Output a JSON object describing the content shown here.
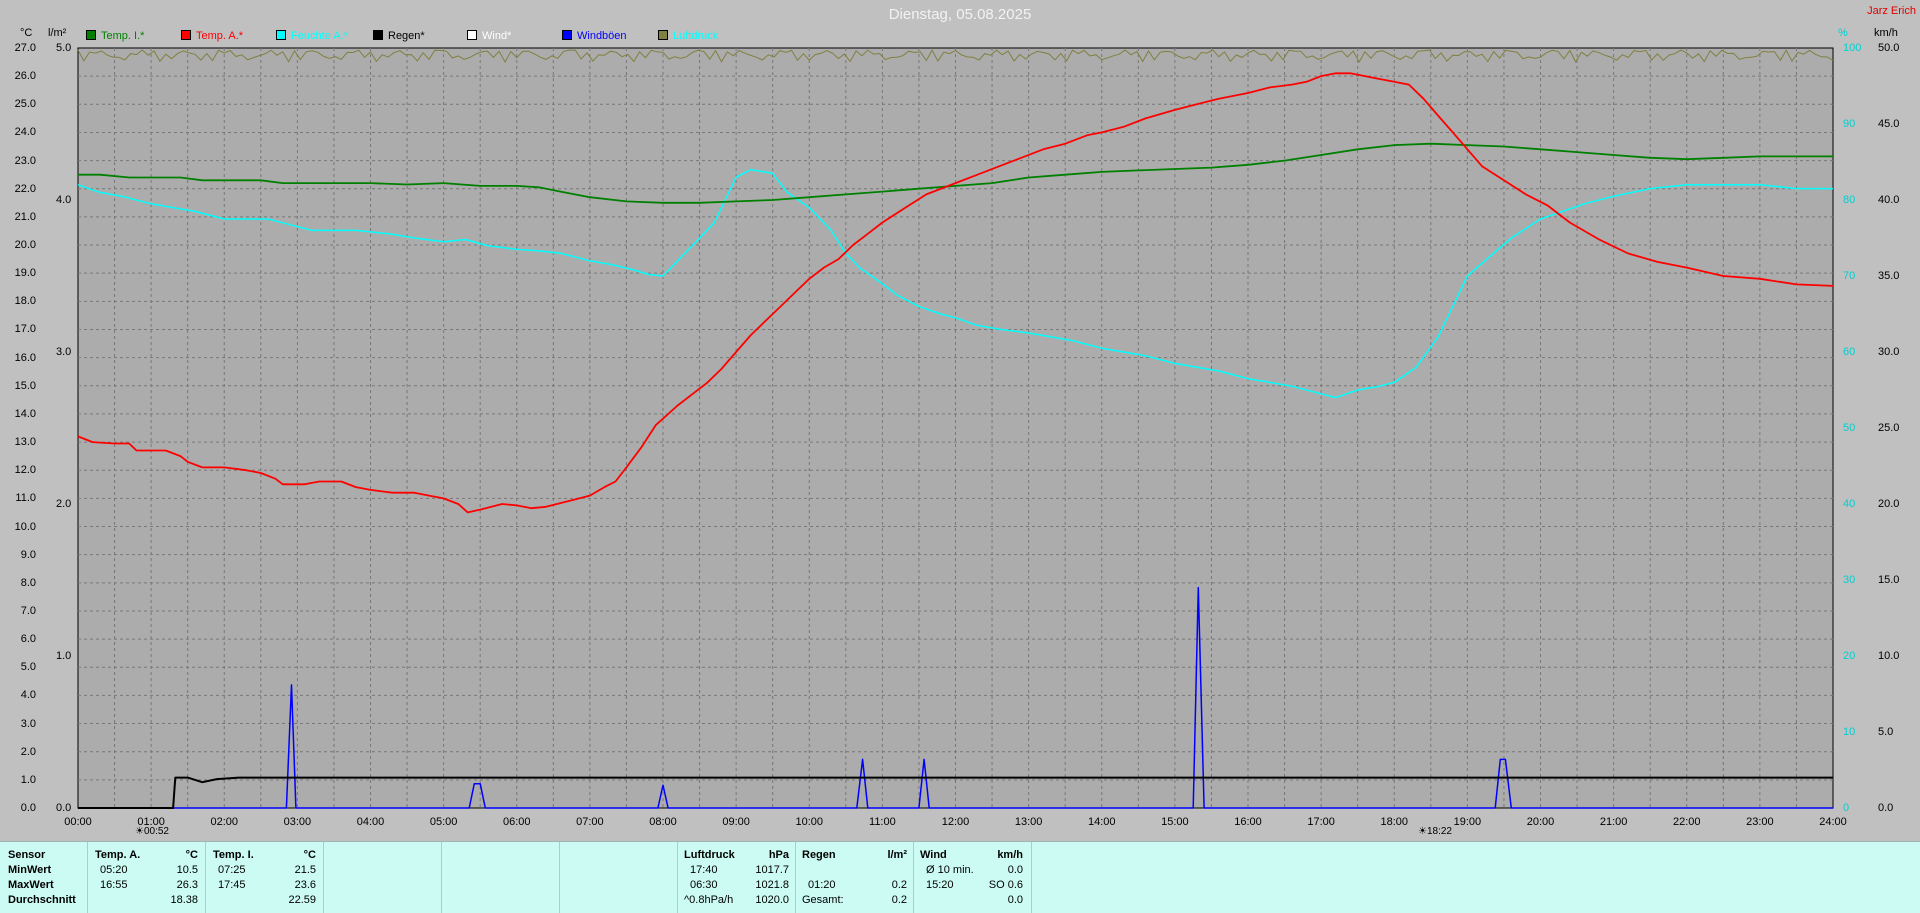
{
  "header": {
    "title": "Dienstag, 05.08.2025",
    "author": "Jarz Erich"
  },
  "units": {
    "temp": "°C",
    "rain": "l/m²",
    "pct": "%",
    "wind": "km/h"
  },
  "legend": [
    {
      "label": "Temp. I.*",
      "color": "#008000"
    },
    {
      "label": "Temp. A.*",
      "color": "#ff0000"
    },
    {
      "label": "Feuchte A.*",
      "color": "#00ffff"
    },
    {
      "label": "Regen*",
      "color": "#000000"
    },
    {
      "label": "Wind*",
      "color": "#ffffff"
    },
    {
      "label": "Windböen",
      "color": "#0000ff"
    },
    {
      "label": "Luftdruck",
      "color": "#808040"
    }
  ],
  "sun": {
    "sunrise": "00:52",
    "sunset": "18:22"
  },
  "chart_data": {
    "type": "line",
    "title": "Dienstag, 05.08.2025",
    "x_ticks": [
      "00:00",
      "01:00",
      "02:00",
      "03:00",
      "04:00",
      "05:00",
      "06:00",
      "07:00",
      "08:00",
      "09:00",
      "10:00",
      "11:00",
      "12:00",
      "13:00",
      "14:00",
      "15:00",
      "16:00",
      "17:00",
      "18:00",
      "19:00",
      "20:00",
      "21:00",
      "22:00",
      "23:00",
      "24:00"
    ],
    "temp_ticks": [
      "27.0",
      "26.0",
      "25.0",
      "24.0",
      "23.0",
      "22.0",
      "21.0",
      "20.0",
      "19.0",
      "18.0",
      "17.0",
      "16.0",
      "15.0",
      "14.0",
      "13.0",
      "12.0",
      "11.0",
      "10.0",
      "9.0",
      "8.0",
      "7.0",
      "6.0",
      "5.0",
      "4.0",
      "3.0",
      "2.0",
      "1.0",
      "0.0"
    ],
    "rain_ticks": [
      "5.0",
      "4.0",
      "3.0",
      "2.0",
      "1.0",
      "0.0"
    ],
    "humidity_ticks": [
      "100",
      "90",
      "80",
      "70",
      "60",
      "50",
      "40",
      "30",
      "20",
      "10",
      "0"
    ],
    "wind_ticks": [
      "50.0",
      "45.0",
      "40.0",
      "35.0",
      "30.0",
      "25.0",
      "20.0",
      "15.0",
      "10.0",
      "5.0",
      "0.0"
    ],
    "ylim_temp": [
      0,
      27
    ],
    "ylim_rain": [
      0,
      5
    ],
    "ylim_humidity": [
      0,
      100
    ],
    "ylim_wind": [
      0,
      50
    ],
    "grid": true,
    "series": [
      {
        "name": "Temp. A.*",
        "color": "#ff0000",
        "axis": "temp",
        "points": [
          [
            0,
            13.2
          ],
          [
            0.2,
            13
          ],
          [
            0.5,
            12.95
          ],
          [
            0.7,
            12.95
          ],
          [
            0.8,
            12.7
          ],
          [
            1.2,
            12.7
          ],
          [
            1.4,
            12.5
          ],
          [
            1.5,
            12.3
          ],
          [
            1.7,
            12.1
          ],
          [
            2,
            12.1
          ],
          [
            2.3,
            12
          ],
          [
            2.5,
            11.9
          ],
          [
            2.7,
            11.7
          ],
          [
            2.8,
            11.5
          ],
          [
            3.1,
            11.5
          ],
          [
            3.3,
            11.6
          ],
          [
            3.6,
            11.6
          ],
          [
            3.8,
            11.4
          ],
          [
            4,
            11.3
          ],
          [
            4.3,
            11.2
          ],
          [
            4.6,
            11.2
          ],
          [
            4.8,
            11.1
          ],
          [
            5,
            11
          ],
          [
            5.2,
            10.8
          ],
          [
            5.33,
            10.5
          ],
          [
            5.5,
            10.6
          ],
          [
            5.8,
            10.8
          ],
          [
            6,
            10.75
          ],
          [
            6.2,
            10.65
          ],
          [
            6.4,
            10.7
          ],
          [
            6.7,
            10.9
          ],
          [
            7,
            11.1
          ],
          [
            7.2,
            11.4
          ],
          [
            7.35,
            11.6
          ],
          [
            7.5,
            12.1
          ],
          [
            7.7,
            12.8
          ],
          [
            7.9,
            13.6
          ],
          [
            8.2,
            14.3
          ],
          [
            8.4,
            14.7
          ],
          [
            8.6,
            15.1
          ],
          [
            8.8,
            15.6
          ],
          [
            9,
            16.2
          ],
          [
            9.2,
            16.8
          ],
          [
            9.4,
            17.3
          ],
          [
            9.6,
            17.8
          ],
          [
            9.8,
            18.3
          ],
          [
            10,
            18.8
          ],
          [
            10.2,
            19.2
          ],
          [
            10.4,
            19.5
          ],
          [
            10.6,
            20
          ],
          [
            10.8,
            20.4
          ],
          [
            11,
            20.8
          ],
          [
            11.3,
            21.3
          ],
          [
            11.6,
            21.8
          ],
          [
            12,
            22.2
          ],
          [
            12.3,
            22.5
          ],
          [
            12.6,
            22.8
          ],
          [
            12.9,
            23.1
          ],
          [
            13.2,
            23.4
          ],
          [
            13.5,
            23.6
          ],
          [
            13.8,
            23.9
          ],
          [
            14,
            24
          ],
          [
            14.3,
            24.2
          ],
          [
            14.6,
            24.5
          ],
          [
            15,
            24.8
          ],
          [
            15.3,
            25
          ],
          [
            15.6,
            25.2
          ],
          [
            16,
            25.4
          ],
          [
            16.3,
            25.6
          ],
          [
            16.6,
            25.7
          ],
          [
            16.8,
            25.8
          ],
          [
            17,
            26
          ],
          [
            17.2,
            26.1
          ],
          [
            17.4,
            26.1
          ],
          [
            17.6,
            26
          ],
          [
            17.8,
            25.9
          ],
          [
            18,
            25.8
          ],
          [
            18.2,
            25.7
          ],
          [
            18.4,
            25.2
          ],
          [
            18.6,
            24.6
          ],
          [
            18.8,
            24
          ],
          [
            19,
            23.4
          ],
          [
            19.2,
            22.8
          ],
          [
            19.5,
            22.3
          ],
          [
            19.8,
            21.8
          ],
          [
            20.1,
            21.4
          ],
          [
            20.4,
            20.8
          ],
          [
            20.8,
            20.2
          ],
          [
            21.2,
            19.7
          ],
          [
            21.6,
            19.4
          ],
          [
            22,
            19.2
          ],
          [
            22.5,
            18.9
          ],
          [
            23,
            18.8
          ],
          [
            23.5,
            18.6
          ],
          [
            24,
            18.55
          ]
        ]
      },
      {
        "name": "Temp. I.*",
        "color": "#008000",
        "axis": "temp",
        "points": [
          [
            0,
            22.5
          ],
          [
            0.3,
            22.5
          ],
          [
            0.7,
            22.4
          ],
          [
            1,
            22.4
          ],
          [
            1.4,
            22.4
          ],
          [
            1.7,
            22.3
          ],
          [
            2,
            22.3
          ],
          [
            2.5,
            22.3
          ],
          [
            2.8,
            22.2
          ],
          [
            3,
            22.2
          ],
          [
            3.5,
            22.2
          ],
          [
            4,
            22.2
          ],
          [
            4.5,
            22.15
          ],
          [
            5,
            22.2
          ],
          [
            5.5,
            22.1
          ],
          [
            6,
            22.1
          ],
          [
            6.3,
            22.05
          ],
          [
            6.6,
            21.9
          ],
          [
            7,
            21.7
          ],
          [
            7.5,
            21.55
          ],
          [
            8,
            21.5
          ],
          [
            8.5,
            21.5
          ],
          [
            9,
            21.55
          ],
          [
            9.5,
            21.6
          ],
          [
            10,
            21.7
          ],
          [
            10.5,
            21.8
          ],
          [
            11,
            21.9
          ],
          [
            11.5,
            22
          ],
          [
            12,
            22.1
          ],
          [
            12.5,
            22.2
          ],
          [
            13,
            22.4
          ],
          [
            13.5,
            22.5
          ],
          [
            14,
            22.6
          ],
          [
            14.5,
            22.65
          ],
          [
            15,
            22.7
          ],
          [
            15.5,
            22.75
          ],
          [
            16,
            22.85
          ],
          [
            16.5,
            23
          ],
          [
            17,
            23.2
          ],
          [
            17.5,
            23.4
          ],
          [
            18,
            23.55
          ],
          [
            18.5,
            23.6
          ],
          [
            19,
            23.55
          ],
          [
            19.5,
            23.5
          ],
          [
            20,
            23.4
          ],
          [
            20.5,
            23.3
          ],
          [
            21,
            23.2
          ],
          [
            21.5,
            23.1
          ],
          [
            22,
            23.05
          ],
          [
            22.5,
            23.1
          ],
          [
            23,
            23.15
          ],
          [
            23.5,
            23.15
          ],
          [
            24,
            23.15
          ]
        ]
      },
      {
        "name": "Feuchte A.*",
        "color": "#00ffff",
        "axis": "humidity",
        "points": [
          [
            0,
            82
          ],
          [
            0.3,
            81
          ],
          [
            0.6,
            80.5
          ],
          [
            1,
            79.5
          ],
          [
            1.3,
            79
          ],
          [
            1.6,
            78.5
          ],
          [
            2,
            77.5
          ],
          [
            2.3,
            77.5
          ],
          [
            2.6,
            77.5
          ],
          [
            2.8,
            77
          ],
          [
            3.2,
            76
          ],
          [
            3.5,
            76
          ],
          [
            3.8,
            76
          ],
          [
            4,
            75.8
          ],
          [
            4.3,
            75.5
          ],
          [
            4.6,
            75
          ],
          [
            5,
            74.5
          ],
          [
            5.3,
            74.8
          ],
          [
            5.6,
            74
          ],
          [
            6,
            73.5
          ],
          [
            6.3,
            73.3
          ],
          [
            6.6,
            73
          ],
          [
            7,
            72
          ],
          [
            7.3,
            71.5
          ],
          [
            7.6,
            70.8
          ],
          [
            7.8,
            70.2
          ],
          [
            8,
            70
          ],
          [
            8.2,
            72
          ],
          [
            8.4,
            74
          ],
          [
            8.7,
            77
          ],
          [
            9,
            83
          ],
          [
            9.2,
            84
          ],
          [
            9.5,
            83.5
          ],
          [
            9.7,
            81
          ],
          [
            10,
            79
          ],
          [
            10.3,
            76
          ],
          [
            10.5,
            73
          ],
          [
            10.7,
            71
          ],
          [
            11,
            69
          ],
          [
            11.2,
            67.5
          ],
          [
            11.5,
            66
          ],
          [
            11.8,
            65
          ],
          [
            12,
            64.5
          ],
          [
            12.3,
            63.5
          ],
          [
            12.6,
            63
          ],
          [
            13,
            62.5
          ],
          [
            13.3,
            62
          ],
          [
            13.6,
            61.5
          ],
          [
            14,
            60.5
          ],
          [
            14.3,
            60
          ],
          [
            14.6,
            59.5
          ],
          [
            15,
            58.5
          ],
          [
            15.3,
            58
          ],
          [
            15.6,
            57.5
          ],
          [
            16,
            56.5
          ],
          [
            16.3,
            56
          ],
          [
            16.6,
            55.5
          ],
          [
            17,
            54.5
          ],
          [
            17.2,
            54
          ],
          [
            17.5,
            55
          ],
          [
            17.8,
            55.5
          ],
          [
            18,
            56
          ],
          [
            18.3,
            58
          ],
          [
            18.6,
            62
          ],
          [
            18.8,
            66
          ],
          [
            19,
            70
          ],
          [
            19.3,
            72.5
          ],
          [
            19.6,
            75
          ],
          [
            20,
            77.5
          ],
          [
            20.3,
            78.5
          ],
          [
            20.6,
            79.5
          ],
          [
            21,
            80.5
          ],
          [
            21.5,
            81.5
          ],
          [
            22,
            82
          ],
          [
            22.5,
            82
          ],
          [
            23,
            82
          ],
          [
            23.5,
            81.5
          ],
          [
            24,
            81.5
          ]
        ]
      },
      {
        "name": "Regen*",
        "color": "#000000",
        "axis": "rain",
        "points": [
          [
            0,
            0
          ],
          [
            1.3,
            0
          ],
          [
            1.33,
            0.2
          ],
          [
            1.5,
            0.2
          ],
          [
            1.7,
            0.17
          ],
          [
            1.9,
            0.19
          ],
          [
            2.2,
            0.2
          ],
          [
            3,
            0.2
          ],
          [
            24,
            0.2
          ]
        ]
      },
      {
        "name": "Windböen",
        "color": "#0000ff",
        "axis": "wind",
        "points": [
          [
            0,
            0
          ],
          [
            2.85,
            0
          ],
          [
            2.92,
            8.1
          ],
          [
            2.98,
            0
          ],
          [
            5.35,
            0
          ],
          [
            5.42,
            1.6
          ],
          [
            5.5,
            1.6
          ],
          [
            5.57,
            0
          ],
          [
            7.93,
            0
          ],
          [
            8.0,
            1.5
          ],
          [
            8.07,
            0
          ],
          [
            10.65,
            0
          ],
          [
            10.73,
            3.2
          ],
          [
            10.8,
            0
          ],
          [
            11.5,
            0
          ],
          [
            11.57,
            3.2
          ],
          [
            11.64,
            0
          ],
          [
            15.25,
            0
          ],
          [
            15.32,
            14.5
          ],
          [
            15.4,
            0
          ],
          [
            19.38,
            0
          ],
          [
            19.45,
            3.2
          ],
          [
            19.52,
            3.2
          ],
          [
            19.6,
            0
          ],
          [
            24,
            0
          ]
        ]
      },
      {
        "name": "Luftdruck",
        "color": "#808040",
        "axis": "pressure",
        "points": [
          [
            0,
            1018.1
          ],
          [
            24,
            1018.1
          ]
        ]
      }
    ]
  },
  "table": {
    "sensor_header": "Sensor",
    "rows": [
      "MinWert",
      "MaxWert",
      "Durchschnitt"
    ],
    "ta": {
      "header": "Temp. A.",
      "unit": "°C",
      "min_time": "05:20",
      "min": "10.5",
      "max_time": "16:55",
      "max": "26.3",
      "avg": "18.38"
    },
    "ti": {
      "header": "Temp. I.",
      "unit": "°C",
      "min_time": "07:25",
      "min": "21.5",
      "max_time": "17:45",
      "max": "23.6",
      "avg": "22.59"
    },
    "druck": {
      "header": "Luftdruck",
      "unit": "hPa",
      "min_time": "17:40",
      "min": "1017.7",
      "max_time": "06:30",
      "max": "1021.8",
      "trend": "^0.8hPa/h",
      "avg": "1020.0"
    },
    "regen": {
      "header": "Regen",
      "unit": "l/m²",
      "time": "01:20",
      "value": "0.2",
      "gesamt_label": "Gesamt:",
      "gesamt": "0.2"
    },
    "wind": {
      "header": "Wind",
      "unit": "km/h",
      "avg_label": "Ø 10 min.",
      "avg": "0.0",
      "max_time": "15:20",
      "max": "SO 0.6",
      "other": "0.0"
    }
  }
}
